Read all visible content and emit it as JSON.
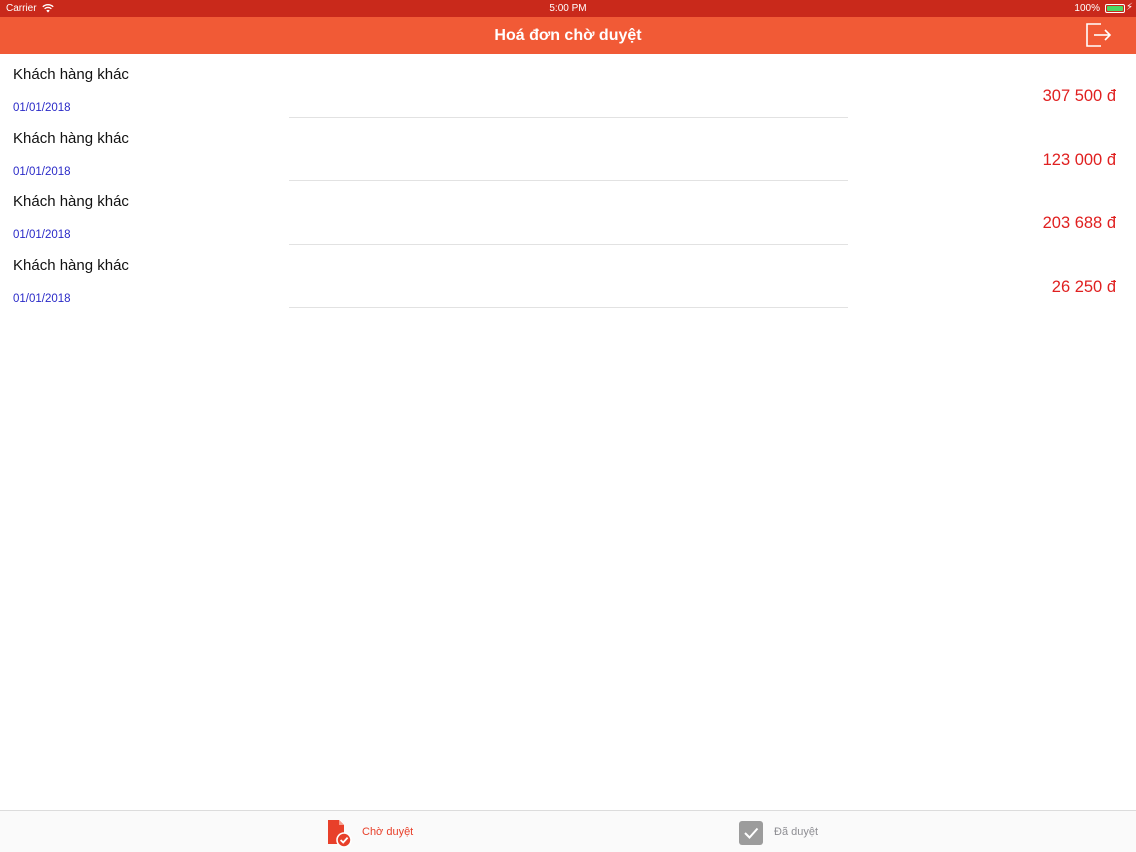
{
  "status_bar": {
    "carrier": "Carrier",
    "time": "5:00 PM",
    "battery": "100%"
  },
  "nav_bar": {
    "title": "Hoá đơn chờ duyệt",
    "logout_icon": "logout-icon"
  },
  "invoices": [
    {
      "customer": "Khách hàng khác",
      "date": "01/01/2018",
      "amount": "307 500 đ"
    },
    {
      "customer": "Khách hàng khác",
      "date": "01/01/2018",
      "amount": "123 000 đ"
    },
    {
      "customer": "Khách hàng khác",
      "date": "01/01/2018",
      "amount": "203 688 đ"
    },
    {
      "customer": "Khách hàng khác",
      "date": "01/01/2018",
      "amount": "26 250 đ"
    }
  ],
  "tab_bar": {
    "pending_label": "Chờ duyệt",
    "approved_label": "Đã duyệt"
  },
  "colors": {
    "status_bar": "#c9291b",
    "nav_bar": "#f15a36",
    "amount": "#e02020",
    "date": "#2a2ac8",
    "tab_active": "#e8402a",
    "tab_inactive": "#8e8e93"
  }
}
